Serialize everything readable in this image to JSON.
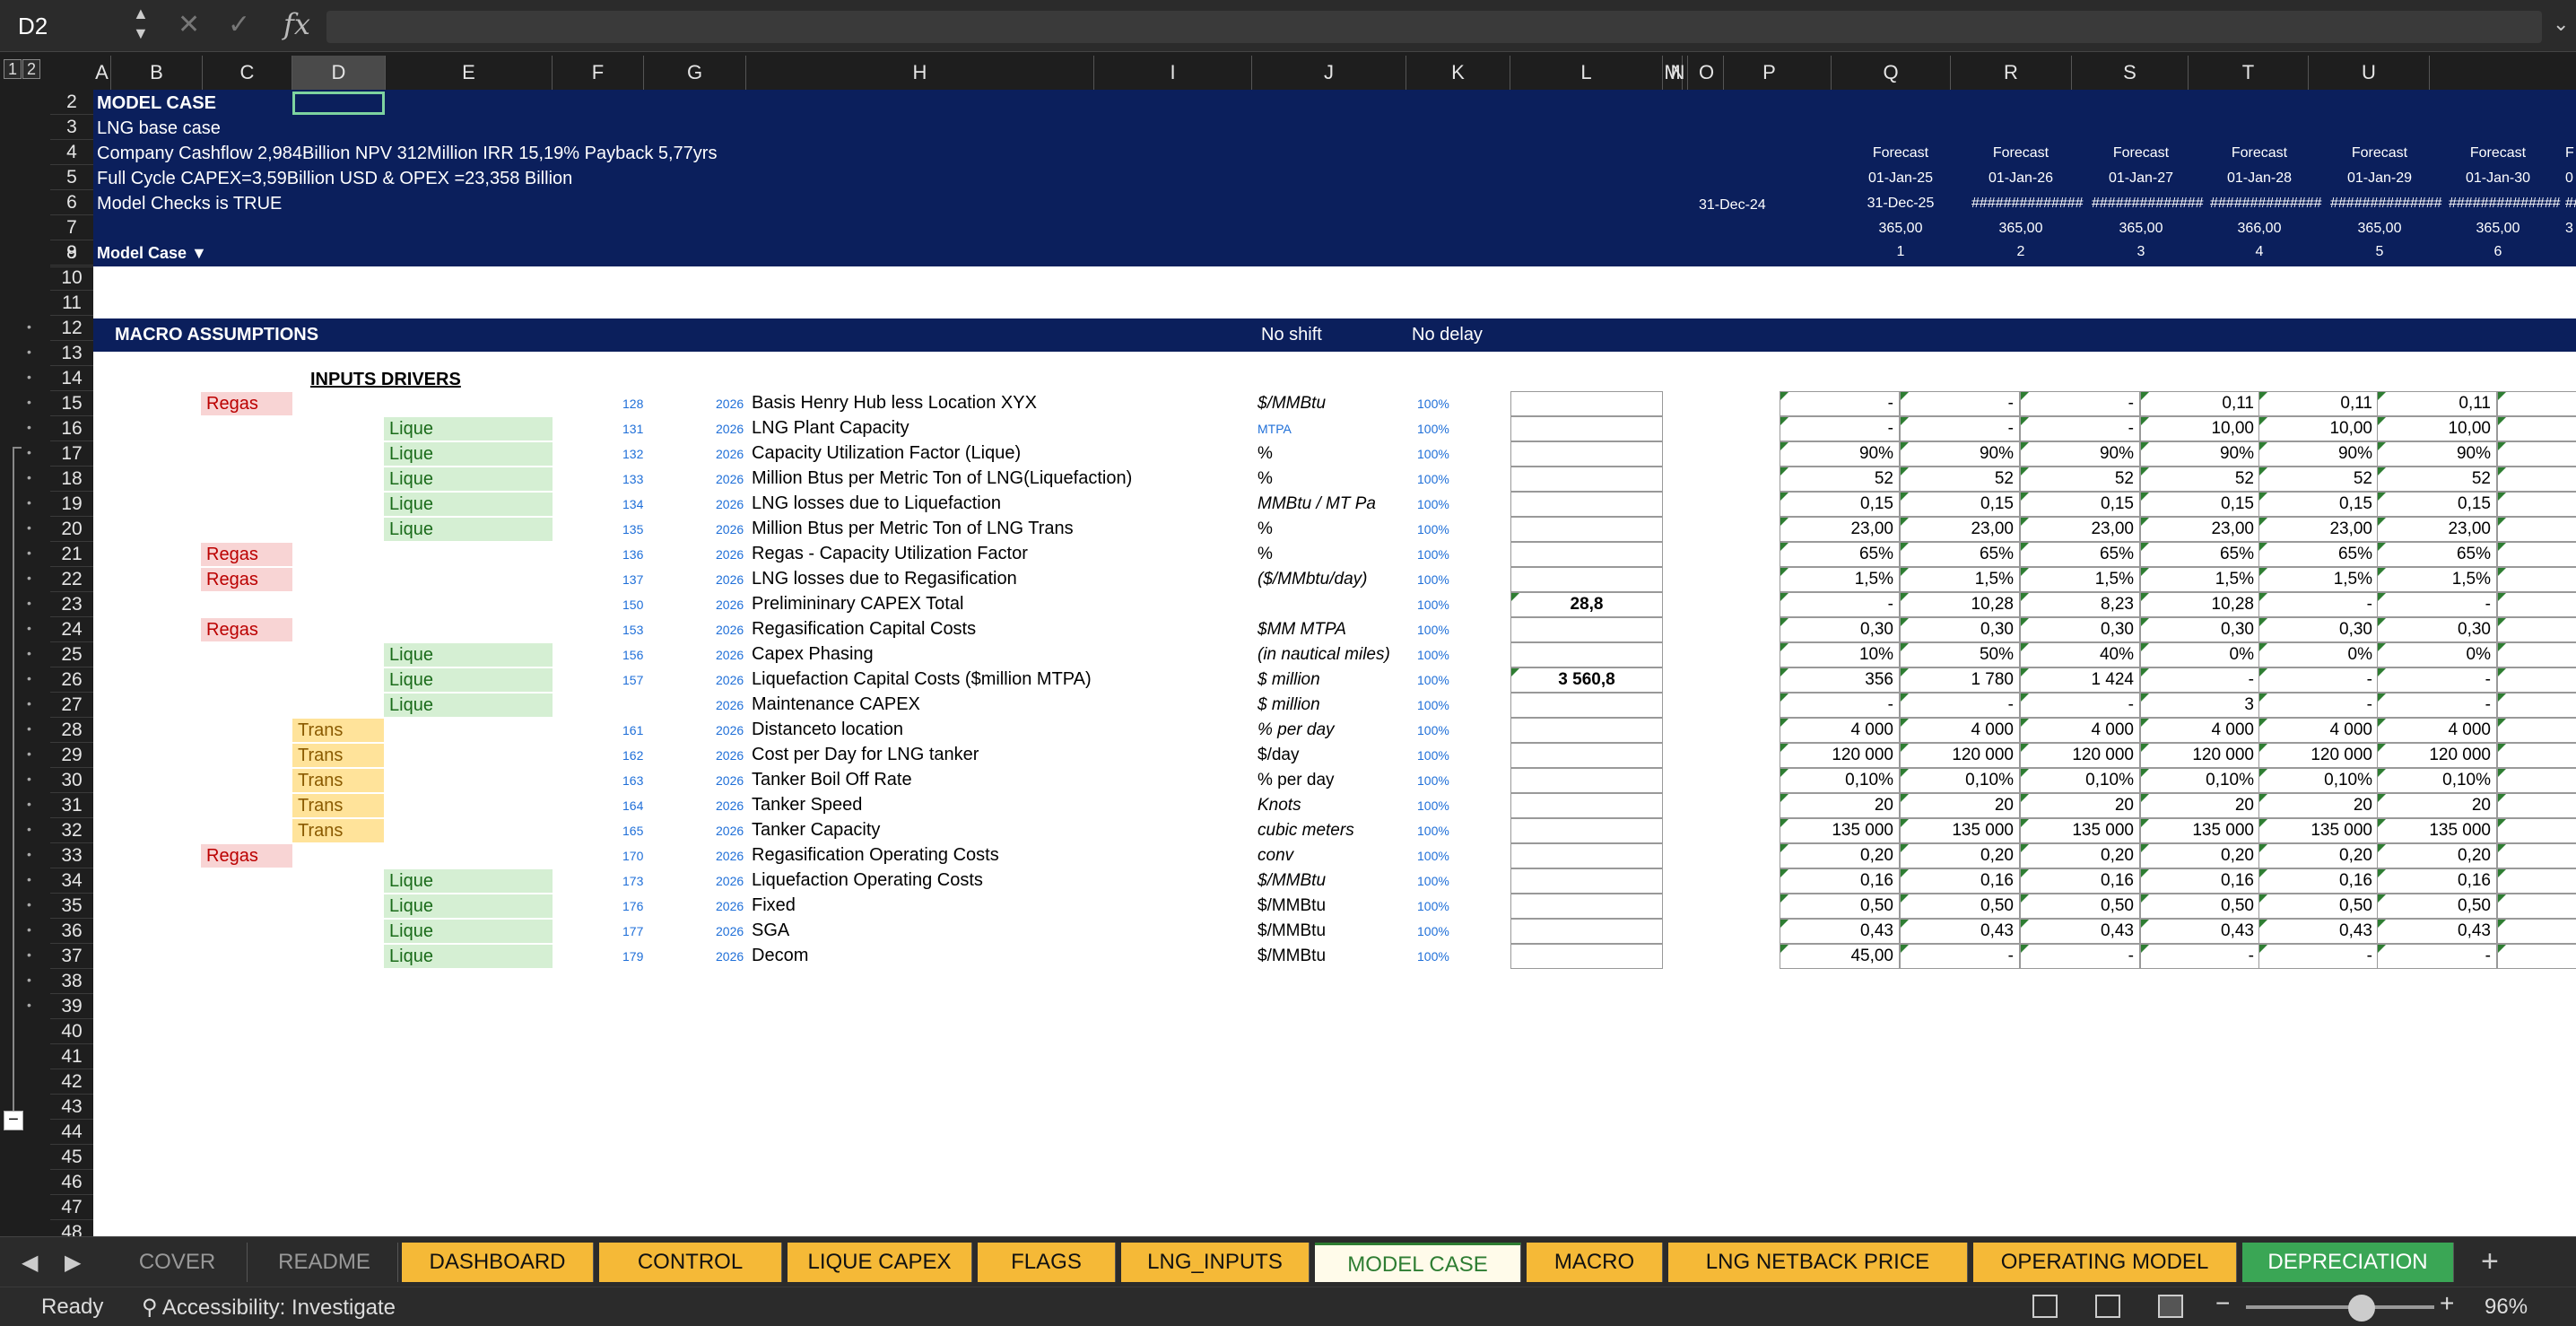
{
  "formula_bar": {
    "cell_ref": "D2",
    "cancel_icon": "✕",
    "enter_icon": "✓",
    "fx": "fx",
    "formula": ""
  },
  "group_levels": [
    "1",
    "2"
  ],
  "columns": [
    "A",
    "B",
    "C",
    "D",
    "E",
    "F",
    "G",
    "H",
    "I",
    "J",
    "K",
    "L",
    "M",
    "N",
    "O",
    "P",
    "Q",
    "R",
    "S",
    "T",
    "U"
  ],
  "rows": [
    "2",
    "3",
    "4",
    "5",
    "6",
    "7",
    "8",
    "9",
    "10",
    "11",
    "12",
    "13",
    "14",
    "15",
    "16",
    "17",
    "18",
    "19",
    "20",
    "21",
    "22",
    "23",
    "24",
    "25",
    "26",
    "27",
    "28",
    "29",
    "30",
    "31",
    "32",
    "33",
    "34",
    "35",
    "36",
    "37",
    "38",
    "39",
    "40",
    "41",
    "42",
    "43",
    "44",
    "45",
    "46",
    "47",
    "48"
  ],
  "banner": {
    "model_case": "MODEL CASE",
    "lng_base": "LNG base  case",
    "cashflow": "Company Cashflow  2,984Billion  NPV 312Million  IRR 15,19% Payback 5,77yrs",
    "capex_opex": "Full Cycle CAPEX=3,59Billion USD & OPEX =23,358 Billion",
    "checks": "Model Checks is TRUE",
    "selector": "Model Case ▼",
    "date_o": "31-Dec-24",
    "forecast_cols": [
      {
        "label": "Forecast",
        "start": "01-Jan-25",
        "end": "31-Dec-25",
        "days": "365,00",
        "period": "1"
      },
      {
        "label": "Forecast",
        "start": "01-Jan-26",
        "end": "##############",
        "days": "365,00",
        "period": "2"
      },
      {
        "label": "Forecast",
        "start": "01-Jan-27",
        "end": "##############",
        "days": "365,00",
        "period": "3"
      },
      {
        "label": "Forecast",
        "start": "01-Jan-28",
        "end": "##############",
        "days": "366,00",
        "period": "4"
      },
      {
        "label": "Forecast",
        "start": "01-Jan-29",
        "end": "##############",
        "days": "365,00",
        "period": "5"
      },
      {
        "label": "Forecast",
        "start": "01-Jan-30",
        "end": "##############",
        "days": "365,00",
        "period": "6"
      }
    ],
    "partial": {
      "label": "F",
      "start": "0",
      "end": "#######",
      "days": "3"
    }
  },
  "macro": {
    "title": "MACRO ASSUMPTIONS",
    "no_shift": "No shift",
    "no_delay": "No delay"
  },
  "inputs_title": "INPUTS DRIVERS",
  "drivers": [
    {
      "row": 15,
      "tag": "Regas",
      "ref": "128",
      "year": "2026",
      "label": "Basis Henry Hub less  Location XYX",
      "unit": "$/MMBtu",
      "unit_style": "it",
      "pct": "100%",
      "l": "",
      "vals": [
        "-",
        "-",
        "-",
        "0,11",
        "0,11",
        "0,11"
      ]
    },
    {
      "row": 16,
      "tag": "Lique",
      "ref": "131",
      "year": "2026",
      "label": "LNG Plant Capacity",
      "unit": "MTPA",
      "unit_style": "blue",
      "pct": "100%",
      "l": "",
      "vals": [
        "-",
        "-",
        "-",
        "10,00",
        "10,00",
        "10,00"
      ]
    },
    {
      "row": 17,
      "tag": "Lique",
      "ref": "132",
      "year": "2026",
      "label": "Capacity Utilization Factor (Lique)",
      "unit": "%",
      "unit_style": "",
      "pct": "100%",
      "l": "",
      "vals": [
        "90%",
        "90%",
        "90%",
        "90%",
        "90%",
        "90%"
      ]
    },
    {
      "row": 18,
      "tag": "Lique",
      "ref": "133",
      "year": "2026",
      "label": "Million Btus per Metric Ton of LNG(Liquefaction)",
      "unit": "%",
      "unit_style": "",
      "pct": "100%",
      "l": "",
      "vals": [
        "52",
        "52",
        "52",
        "52",
        "52",
        "52"
      ]
    },
    {
      "row": 19,
      "tag": "Lique",
      "ref": "134",
      "year": "2026",
      "label": "LNG losses due to Liquefaction",
      "unit": "MMBtu / MT Pa",
      "unit_style": "it",
      "pct": "100%",
      "l": "",
      "vals": [
        "0,15",
        "0,15",
        "0,15",
        "0,15",
        "0,15",
        "0,15"
      ]
    },
    {
      "row": 20,
      "tag": "Lique",
      "ref": "135",
      "year": "2026",
      "label": "Million Btus per Metric Ton of LNG Trans",
      "unit": "%",
      "unit_style": "",
      "pct": "100%",
      "l": "",
      "vals": [
        "23,00",
        "23,00",
        "23,00",
        "23,00",
        "23,00",
        "23,00"
      ]
    },
    {
      "row": 21,
      "tag": "Regas",
      "ref": "136",
      "year": "2026",
      "label": " Regas - Capacity Utilization Factor",
      "unit": "%",
      "unit_style": "",
      "pct": "100%",
      "l": "",
      "vals": [
        "65%",
        "65%",
        "65%",
        "65%",
        "65%",
        "65%"
      ]
    },
    {
      "row": 22,
      "tag": "Regas",
      "ref": "137",
      "year": "2026",
      "label": "LNG losses due to Regasification",
      "unit": " ($/MMbtu/day)",
      "unit_style": "it",
      "pct": "100%",
      "l": "",
      "vals": [
        "1,5%",
        "1,5%",
        "1,5%",
        "1,5%",
        "1,5%",
        "1,5%"
      ]
    },
    {
      "row": 23,
      "tag": "",
      "ref": "150",
      "year": "2026",
      "label": "Prelimininary CAPEX Total",
      "unit": "",
      "unit_style": "",
      "pct": "100%",
      "l": "28,8",
      "vals": [
        "-",
        "10,28",
        "8,23",
        "10,28",
        "-",
        "-"
      ]
    },
    {
      "row": 24,
      "tag": "Regas",
      "ref": "153",
      "year": "2026",
      "label": "Regasification Capital Costs",
      "unit": "$MM MTPA",
      "unit_style": "it",
      "pct": "100%",
      "l": "",
      "vals": [
        "0,30",
        "0,30",
        "0,30",
        "0,30",
        "0,30",
        "0,30"
      ]
    },
    {
      "row": 25,
      "tag": "Lique",
      "ref": "156",
      "year": "2026",
      "label": "Capex Phasing",
      "unit": "(in nautical miles)",
      "unit_style": "it",
      "pct": "100%",
      "l": "",
      "vals": [
        "10%",
        "50%",
        "40%",
        "0%",
        "0%",
        "0%"
      ]
    },
    {
      "row": 26,
      "tag": "Lique",
      "ref": "157",
      "year": "2026",
      "label": "Liquefaction Capital Costs ($million MTPA)",
      "unit": "$ million",
      "unit_style": "it",
      "pct": "100%",
      "l": "3 560,8",
      "vals": [
        "356",
        "1 780",
        "1 424",
        "-",
        "-",
        "-"
      ]
    },
    {
      "row": 27,
      "tag": "Lique",
      "ref": "",
      "year": "2026",
      "label": "Maintenance CAPEX",
      "unit": "$ million",
      "unit_style": "it",
      "pct": "100%",
      "l": "",
      "vals": [
        "-",
        "-",
        "-",
        "3",
        "-",
        "-"
      ]
    },
    {
      "row": 28,
      "tag": "Trans",
      "ref": "161",
      "year": "2026",
      "label": "Distanceto location",
      "unit": "% per day",
      "unit_style": "it",
      "pct": "100%",
      "l": "",
      "vals": [
        "4 000",
        "4 000",
        "4 000",
        "4 000",
        "4 000",
        "4 000"
      ]
    },
    {
      "row": 29,
      "tag": "Trans",
      "ref": "162",
      "year": "2026",
      "label": "Cost per Day for LNG tanker",
      "unit": "$/day",
      "unit_style": "",
      "pct": "100%",
      "l": "",
      "vals": [
        "120 000",
        "120 000",
        "120 000",
        "120 000",
        "120 000",
        "120 000"
      ]
    },
    {
      "row": 30,
      "tag": "Trans",
      "ref": "163",
      "year": "2026",
      "label": "Tanker Boil Off Rate",
      "unit": "% per day",
      "unit_style": "",
      "pct": "100%",
      "l": "",
      "vals": [
        "0,10%",
        "0,10%",
        "0,10%",
        "0,10%",
        "0,10%",
        "0,10%"
      ]
    },
    {
      "row": 31,
      "tag": "Trans",
      "ref": "164",
      "year": "2026",
      "label": "Tanker Speed",
      "unit": "Knots",
      "unit_style": "it",
      "pct": "100%",
      "l": "",
      "vals": [
        "20",
        "20",
        "20",
        "20",
        "20",
        "20"
      ]
    },
    {
      "row": 32,
      "tag": "Trans",
      "ref": "165",
      "year": "2026",
      "label": "Tanker Capacity",
      "unit": "cubic meters",
      "unit_style": "it",
      "pct": "100%",
      "l": "",
      "vals": [
        "135 000",
        "135 000",
        "135 000",
        "135 000",
        "135 000",
        "135 000"
      ]
    },
    {
      "row": 33,
      "tag": "Regas",
      "ref": "170",
      "year": "2026",
      "label": "Regasification Operating Costs",
      "unit": "conv",
      "unit_style": "it",
      "pct": "100%",
      "l": "",
      "vals": [
        "0,20",
        "0,20",
        "0,20",
        "0,20",
        "0,20",
        "0,20"
      ]
    },
    {
      "row": 34,
      "tag": "Lique",
      "ref": "173",
      "year": "2026",
      "label": "Liquefaction Operating Costs",
      "unit": "$/MMBtu",
      "unit_style": "it",
      "pct": "100%",
      "l": "",
      "vals": [
        "0,16",
        "0,16",
        "0,16",
        "0,16",
        "0,16",
        "0,16"
      ]
    },
    {
      "row": 35,
      "tag": "Lique",
      "ref": "176",
      "year": "2026",
      "label": "Fixed",
      "unit": "$/MMBtu",
      "unit_style": "",
      "pct": "100%",
      "l": "",
      "vals": [
        "0,50",
        "0,50",
        "0,50",
        "0,50",
        "0,50",
        "0,50"
      ]
    },
    {
      "row": 36,
      "tag": "Lique",
      "ref": "177",
      "year": "2026",
      "label": "SGA",
      "unit": "$/MMBtu",
      "unit_style": "",
      "pct": "100%",
      "l": "",
      "vals": [
        "0,43",
        "0,43",
        "0,43",
        "0,43",
        "0,43",
        "0,43"
      ]
    },
    {
      "row": 37,
      "tag": "Lique",
      "ref": "179",
      "year": "2026",
      "label": "Decom",
      "unit": "$/MMBtu",
      "unit_style": "",
      "pct": "100%",
      "l": "",
      "vals": [
        "45,00",
        "-",
        "-",
        "-",
        "-",
        "-"
      ]
    }
  ],
  "sheet_tabs": [
    {
      "label": "COVER",
      "style": "gray"
    },
    {
      "label": "README",
      "style": "gray"
    },
    {
      "label": "DASHBOARD",
      "style": "yellow"
    },
    {
      "label": "CONTROL",
      "style": "yellow"
    },
    {
      "label": "LIQUE CAPEX",
      "style": "yellow"
    },
    {
      "label": "FLAGS",
      "style": "yellow"
    },
    {
      "label": "LNG_INPUTS",
      "style": "yellow"
    },
    {
      "label": "MODEL CASE",
      "style": "active"
    },
    {
      "label": "MACRO",
      "style": "yellow"
    },
    {
      "label": "LNG NETBACK PRICE",
      "style": "yellow"
    },
    {
      "label": "OPERATING MODEL",
      "style": "yellow"
    },
    {
      "label": "DEPRECIATION",
      "style": "green"
    }
  ],
  "status": {
    "ready": "Ready",
    "accessibility": "Accessibility: Investigate",
    "zoom": "96%",
    "zoom_value_pct": 96
  }
}
